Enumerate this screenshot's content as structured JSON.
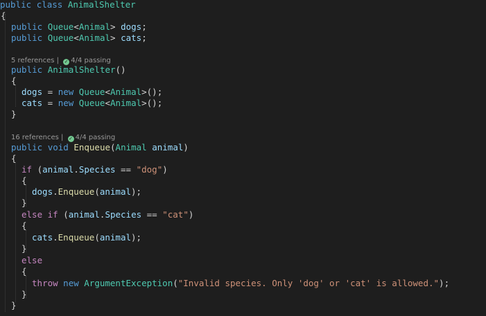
{
  "code": {
    "class_decl": {
      "public": "public",
      "class": "class",
      "name": "AnimalShelter"
    },
    "open_brace": "{",
    "close_brace": "}",
    "field_dogs": {
      "public": "public",
      "type": "Queue",
      "generic": "Animal",
      "name": "dogs"
    },
    "field_cats": {
      "public": "public",
      "type": "Queue",
      "generic": "Animal",
      "name": "cats"
    },
    "ctor": {
      "public": "public",
      "name": "AnimalShelter",
      "params": "()"
    },
    "ctor_body": {
      "dogs": {
        "var": "dogs",
        "new": "new",
        "type": "Queue",
        "generic": "Animal"
      },
      "cats": {
        "var": "cats",
        "new": "new",
        "type": "Queue",
        "generic": "Animal"
      }
    },
    "enqueue": {
      "public": "public",
      "void": "void",
      "name": "Enqueue",
      "param_type": "Animal",
      "param_name": "animal",
      "if_kw": "if",
      "else_if_kw": "else if",
      "else_kw": "else",
      "animal": "animal",
      "species": "Species",
      "dog_str": "\"dog\"",
      "cat_str": "\"cat\"",
      "dogs": "dogs",
      "cats": "cats",
      "enqueue_fn": "Enqueue",
      "throw": "throw",
      "new": "new",
      "exception": "ArgumentException",
      "exception_msg": "\"Invalid species. Only 'dog' or 'cat' is allowed.\""
    }
  },
  "codelens": {
    "ctor": {
      "references": "5 references",
      "passing": "4/4 passing"
    },
    "enqueue": {
      "references": "16 references",
      "passing": "4/4 passing"
    }
  },
  "colors": {
    "background": "#1e1e1e",
    "keyword": "#569cd6",
    "control": "#c586c0",
    "type": "#4ec9b0",
    "function": "#dcdcaa",
    "variable": "#9cdcfe",
    "string": "#ce9178",
    "pass": "#73c991"
  }
}
